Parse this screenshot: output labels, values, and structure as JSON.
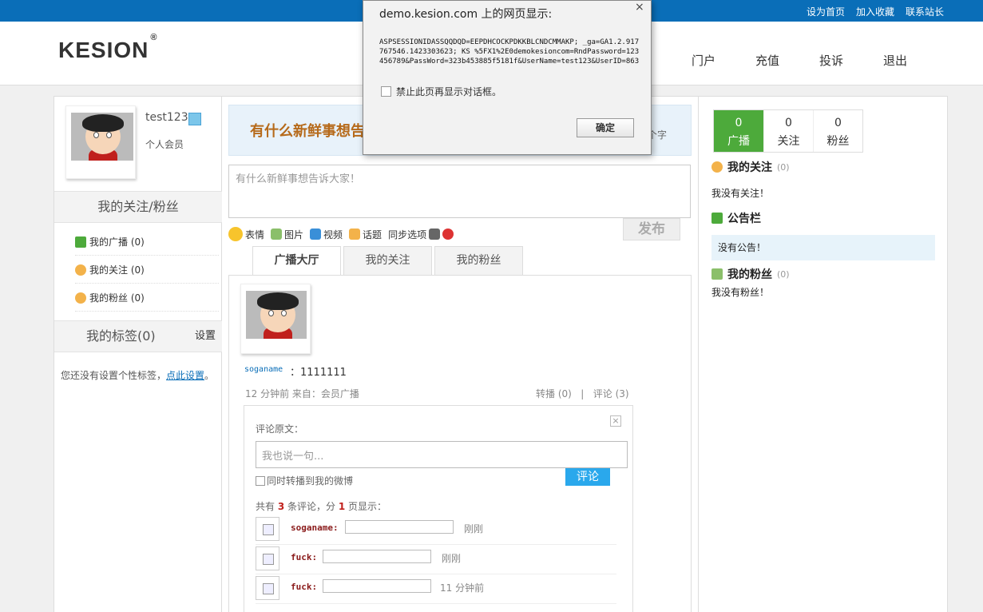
{
  "topbar": {
    "links": [
      "设为首页",
      "加入收藏",
      "联系站长"
    ]
  },
  "header": {
    "logo": "KESION",
    "nav": [
      "门户",
      "充值",
      "投诉",
      "退出"
    ]
  },
  "profile": {
    "username": "test123",
    "role": "个人会员"
  },
  "left": {
    "follow_title": "我的关注/粉丝",
    "items": [
      "我的广播 (0)",
      "我的关注 (0)",
      "我的粉丝 (0)"
    ],
    "tags_title": "我的标签(0)",
    "tags_setting": "设置",
    "tags_note": "您还没有设置个性标签，",
    "tags_link": "点此设置",
    "tags_end": "。"
  },
  "composer": {
    "slogan": "有什么新鲜事想告诉",
    "count_suffix": "个字",
    "placeholder": "有什么新鲜事想告诉大家！",
    "tools": [
      "表情",
      "图片",
      "视频",
      "话题",
      "同步选项"
    ],
    "publish": "发布"
  },
  "tabs": [
    "广播大厅",
    "我的关注",
    "我的粉丝"
  ],
  "feed": {
    "author": "soganame",
    "message": "：1111111",
    "meta": "12 分钟前   来自：会员广播",
    "repost": "转播 (0)",
    "sep": "|",
    "comment": "评论 (3)"
  },
  "comments": {
    "orig_label": "评论原文：",
    "input_placeholder": "我也说一句...",
    "sync": "同时转播到我的微博",
    "button": "评论",
    "total_pre": "共有 ",
    "total_count": "3",
    "total_mid": " 条评论，分 ",
    "total_pages": "1",
    "total_post": " 页显示：",
    "rows": [
      {
        "name": "soganame",
        "sep": ":",
        "time": "刚刚"
      },
      {
        "name": "fuck",
        "sep": ":",
        "time": "刚刚"
      },
      {
        "name": "fuck",
        "sep": ":",
        "time": "11 分钟前"
      }
    ]
  },
  "right": {
    "stats": [
      {
        "value": "0",
        "label": "广播"
      },
      {
        "value": "0",
        "label": "关注"
      },
      {
        "value": "0",
        "label": "粉丝"
      }
    ],
    "follow_title": "我的关注",
    "follow_count": "(0)",
    "follow_empty": "我没有关注！",
    "notice_title": "公告栏",
    "notice_empty": "没有公告！",
    "fans_title": "我的粉丝",
    "fans_count": "(0)",
    "fans_empty": "我没有粉丝！"
  },
  "dialog": {
    "title": "demo.kesion.com 上的网页显示:",
    "close": "×",
    "message": "ASPSESSIONIDASSQQDQD=EEPDHCOCKPDKKBLCNDCMMAKP; _ga=GA1.2.917767546.1423303623; KS %5FX1%2E0demokesioncom=RndPassword=123456789&PassWord=323b453885f5181f&UserName=test123&UserID=863",
    "checkbox": "禁止此页再显示对话框。",
    "ok": "确定"
  }
}
